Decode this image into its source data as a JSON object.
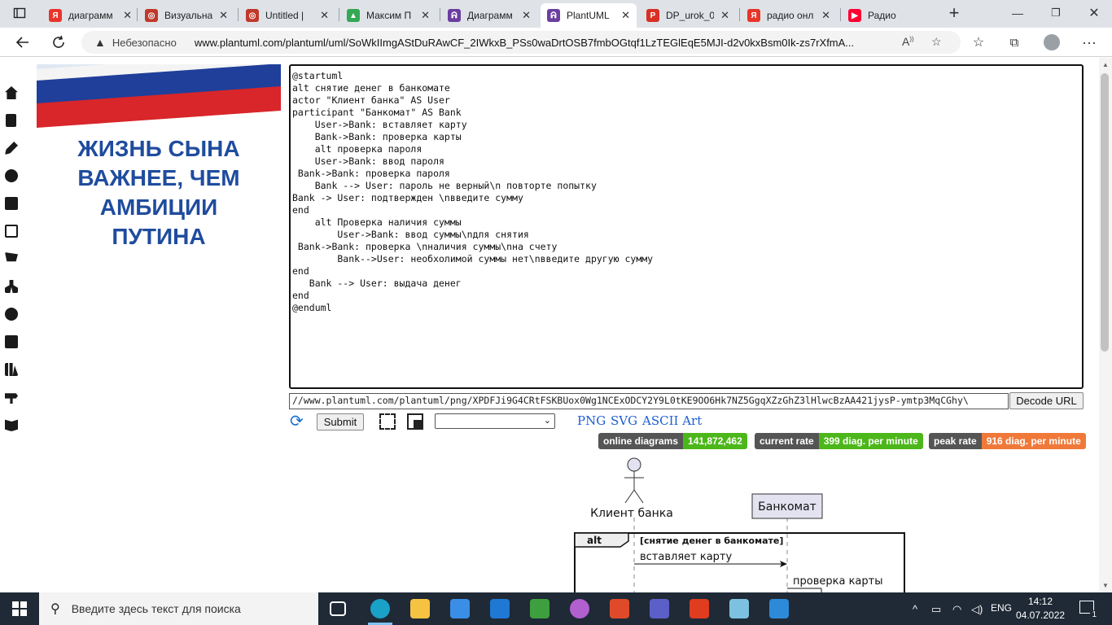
{
  "browser": {
    "tabs": [
      {
        "title": "диаграмм",
        "favicon": "yandex-icon",
        "color": "#e8352a",
        "glyph": "Я"
      },
      {
        "title": "Визуальна",
        "favicon": "chrome-icon",
        "color": "#c0392b",
        "glyph": "◎"
      },
      {
        "title": "Untitled | ",
        "favicon": "chrome-icon",
        "color": "#c0392b",
        "glyph": "◎"
      },
      {
        "title": "Максим П",
        "favicon": "google-drive-icon",
        "color": "#34a853",
        "glyph": "▲"
      },
      {
        "title": "Диаграмм",
        "favicon": "plantuml-icon",
        "color": "#6b3fa0",
        "glyph": "ᕱ"
      },
      {
        "title": "PlantUML",
        "favicon": "plantuml-icon",
        "color": "#6b3fa0",
        "glyph": "ᕱ",
        "active": true
      },
      {
        "title": "DP_urok_0",
        "favicon": "pdf-icon",
        "color": "#d93025",
        "glyph": "P"
      },
      {
        "title": "радио онл",
        "favicon": "yandex-icon",
        "color": "#e8352a",
        "glyph": "Я"
      },
      {
        "title": "Радио",
        "favicon": "youtube-icon",
        "color": "#ff0033",
        "glyph": "▶"
      }
    ],
    "address": {
      "security_label": "Небезопасно",
      "url": "www.plantuml.com/plantuml/uml/SoWkIImgAStDuRAwCF_2IWkxB_PSs0waDrtOSB7fmbOGtqf1LzTEGlEqE5MJI-d2v0kxBsm0Ik-zs7rXfmA..."
    }
  },
  "banner": {
    "lines": [
      "ЖИЗНЬ СЫНА",
      "ВАЖНЕЕ, ЧЕМ",
      "АМБИЦИИ",
      "ПУТИНА"
    ]
  },
  "editor": {
    "lines": [
      "@startuml",
      "alt снятие денег в банкомате",
      "actor \"Клиент банка\" AS User",
      "participant \"Банкомат\" AS Bank",
      "    User->Bank: вставляет карту",
      "    Bank->Bank: проверка карты",
      "    alt проверка пароля",
      "    User->Bank: ввод пароля",
      " Bank->Bank: проверка пароля",
      "    Bank --> User: пароль не верный\\n повторте попытку",
      "Bank -> User: подтвержден \\nввeдите сумму",
      "end",
      "    alt Проверка наличия суммы",
      "        User->Bank: ввод суммы\\nдля снятия",
      " Bank->Bank: проверка \\nналичия суммы\\nна счету",
      "        Bank-->User: необхолимой суммы нет\\nвведите другую сумму",
      "end",
      "   Bank --> User: выдача денег",
      "end",
      "@enduml"
    ]
  },
  "toolbar": {
    "url_value": "//www.plantuml.com/plantuml/png/XPDFJi9G4CRtFSKBUox0Wg1NCExODCY2Y9L0tKE9OO6Hk7NZ5GgqXZzGhZ3lHlwcBzAA421jysP-ymtp3MqCGhy\\",
    "decode_label": "Decode URL",
    "submit_label": "Submit",
    "select_value": "",
    "formats": [
      "PNG",
      "SVG",
      "ASCII Art"
    ]
  },
  "stats": {
    "online": {
      "label": "online diagrams",
      "value": "141,872,462",
      "color": "#4cb71a"
    },
    "current": {
      "label": "current rate",
      "value": "399 diag. per minute",
      "color": "#4cb71a"
    },
    "peak": {
      "label": "peak rate",
      "value": "916 diag. per minute",
      "color": "#f0793a"
    }
  },
  "diagram": {
    "actor": "Клиент банка",
    "participant": "Банкомат",
    "frame_label": "alt",
    "frame_guard": "[снятие денег в банкомате]",
    "msg1": "вставляет карту",
    "msg2": "проверка карты"
  },
  "taskbar": {
    "search_placeholder": "Введите здесь текст для поиска",
    "language": "ENG",
    "time": "14:12",
    "date": "04.07.2022",
    "notification_count": "1"
  }
}
